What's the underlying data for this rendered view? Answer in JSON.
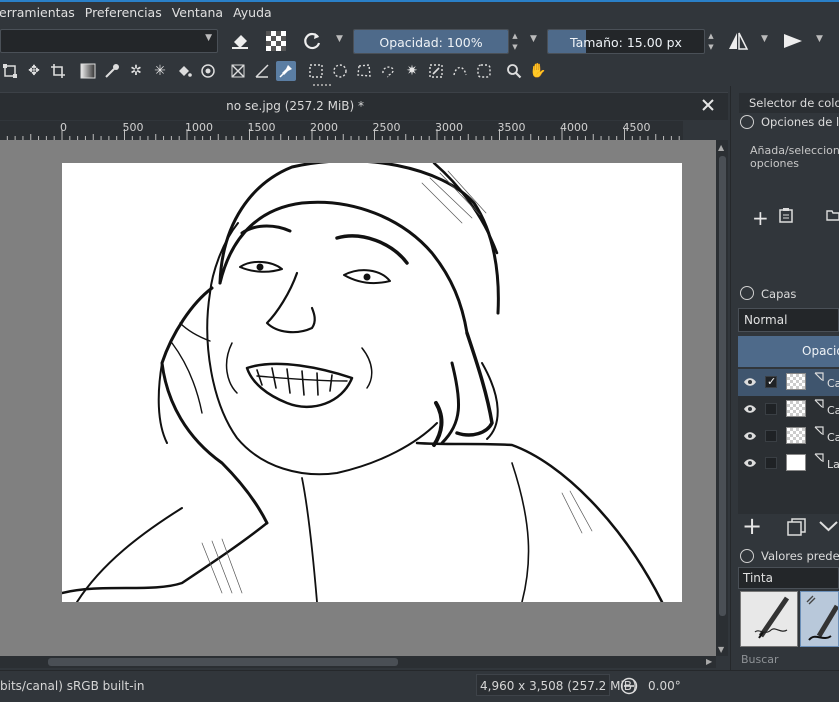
{
  "menu": [
    {
      "id": "herramientas",
      "label": "erramientas"
    },
    {
      "id": "preferencias",
      "label": "Preferencias"
    },
    {
      "id": "ventana",
      "label": "Ventana"
    },
    {
      "id": "ayuda",
      "label": "Ayuda"
    }
  ],
  "toolbar": {
    "opacity_label": "Opacidad: 100%",
    "opacity_value": 1.0,
    "size_label": "Tamaño: 15.00 px"
  },
  "document": {
    "tab_title": "no se.jpg (257.2 MiB) *"
  },
  "ruler": {
    "labels": [
      "0",
      "500",
      "1000",
      "1500",
      "2000",
      "2500",
      "3000",
      "3500",
      "4000",
      "4500"
    ]
  },
  "dock": {
    "color_selector_tab": "Selector de color",
    "tool_options_title": "Opciones de la",
    "tool_options_hint": "Añada/seleccione opciones",
    "layers_title": "Capas",
    "blend_mode": "Normal",
    "opacity_label": "Opacid",
    "layers": [
      {
        "name": "Ca",
        "selected": true,
        "thumb": "checker",
        "check": "✓"
      },
      {
        "name": "Ca",
        "selected": false,
        "thumb": "checker",
        "check": ""
      },
      {
        "name": "Ca",
        "selected": false,
        "thumb": "checker",
        "check": ""
      },
      {
        "name": "Lay",
        "selected": false,
        "thumb": "white",
        "check": ""
      }
    ],
    "presets_title": "Valores predefi",
    "preset_category": "Tinta",
    "search_placeholder": "Buscar"
  },
  "status": {
    "colorspace": "bits/canal)  sRGB built-in",
    "dimensions": "4,960 x 3,508 (257.2 MiB)",
    "rotation": "0.00°"
  },
  "colors": {
    "accent": "#4e6a8a",
    "background": "#31363b",
    "canvas_bg": "#808080"
  }
}
